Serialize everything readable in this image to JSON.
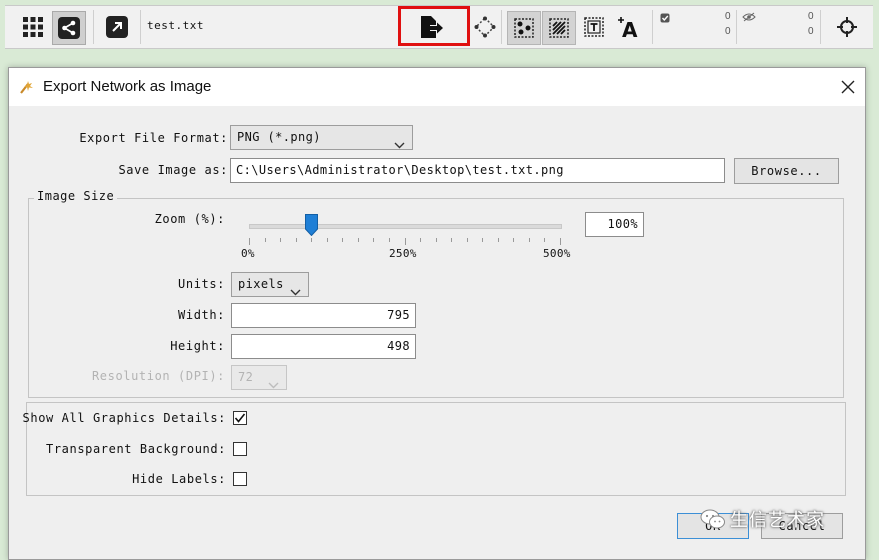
{
  "toolbar": {
    "filename": "test.txt",
    "count_top_left": "0",
    "count_bottom_left": "0",
    "count_top_right": "0",
    "count_bottom_right": "0",
    "highlight_color": "#e01010"
  },
  "dialog": {
    "title": "Export Network as Image",
    "export_format_label": "Export File Format:",
    "export_format_value": "PNG (*.png)",
    "save_as_label": "Save Image as:",
    "save_as_value": "C:\\Users\\Administrator\\Desktop\\test.txt.png",
    "browse_label": "Browse...",
    "image_size_legend": "Image Size",
    "zoom_label": "Zoom (%):",
    "zoom_value": "100%",
    "zoom_level_percent": 100,
    "zoom_tick_min": "0%",
    "zoom_tick_mid": "250%",
    "zoom_tick_max": "500%",
    "units_label": "Units:",
    "units_value": "pixels",
    "width_label": "Width:",
    "width_value": "795",
    "height_label": "Height:",
    "height_value": "498",
    "resolution_label": "Resolution (DPI):",
    "resolution_value": "72",
    "show_details_label": "Show All Graphics Details:",
    "show_details_checked": true,
    "transparent_label": "Transparent Background:",
    "transparent_checked": false,
    "hide_labels_label": "Hide Labels:",
    "hide_labels_checked": false,
    "ok_label": "OK",
    "cancel_label": "Cancel"
  },
  "watermark": "生信艺术家",
  "icons": [
    "grid-icon",
    "share-network-icon",
    "external-link-icon",
    "export-image-icon",
    "first-neighbors-icon",
    "select-nodes-icon",
    "select-edges-icon",
    "annotation-text-box-icon",
    "annotation-text-icon",
    "node-count-icon",
    "hidden-count-icon",
    "target-icon",
    "app-icon",
    "close-icon"
  ]
}
